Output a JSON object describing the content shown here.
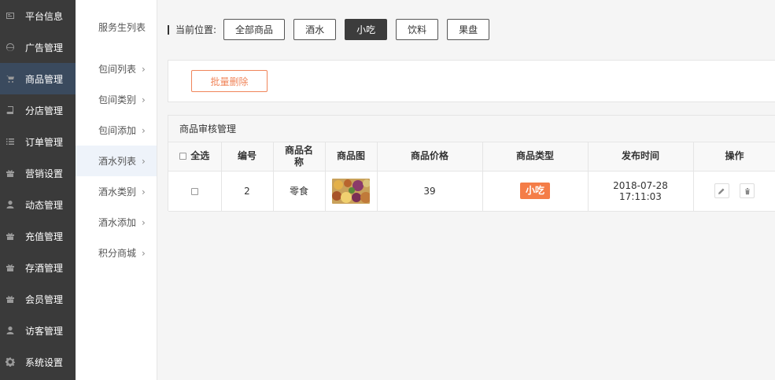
{
  "sidebar": {
    "items": [
      {
        "label": "平台信息",
        "icon": "id-card-icon",
        "active": false
      },
      {
        "label": "广告管理",
        "icon": "globe-icon",
        "active": false
      },
      {
        "label": "商品管理",
        "icon": "cart-icon",
        "active": true
      },
      {
        "label": "分店管理",
        "icon": "book-icon",
        "active": false
      },
      {
        "label": "订单管理",
        "icon": "list-icon",
        "active": false
      },
      {
        "label": "营销设置",
        "icon": "gift-icon",
        "active": false
      },
      {
        "label": "动态管理",
        "icon": "user-icon",
        "active": false
      },
      {
        "label": "充值管理",
        "icon": "gift-icon",
        "active": false
      },
      {
        "label": "存酒管理",
        "icon": "gift-icon",
        "active": false
      },
      {
        "label": "会员管理",
        "icon": "gift-icon",
        "active": false
      },
      {
        "label": "访客管理",
        "icon": "user-icon",
        "active": false
      },
      {
        "label": "系统设置",
        "icon": "gear-icon",
        "active": false
      }
    ]
  },
  "subnav": {
    "items": [
      {
        "label": "服务生列表",
        "chevron": false,
        "active": false
      },
      {
        "label": "包间列表",
        "chevron": true,
        "active": false
      },
      {
        "label": "包间类别",
        "chevron": true,
        "active": false
      },
      {
        "label": "包间添加",
        "chevron": true,
        "active": false
      },
      {
        "label": "酒水列表",
        "chevron": true,
        "active": true
      },
      {
        "label": "酒水类别",
        "chevron": true,
        "active": false
      },
      {
        "label": "酒水添加",
        "chevron": true,
        "active": false
      },
      {
        "label": "积分商城",
        "chevron": true,
        "active": false
      }
    ],
    "chevron_glyph": "›"
  },
  "breadcrumb": {
    "label": "当前位置:",
    "filters": [
      {
        "label": "全部商品",
        "active": false
      },
      {
        "label": "酒水",
        "active": false
      },
      {
        "label": "小吃",
        "active": true
      },
      {
        "label": "饮料",
        "active": false
      },
      {
        "label": "果盘",
        "active": false
      }
    ]
  },
  "toolbar": {
    "batch_delete_label": "批量删除"
  },
  "panel": {
    "title": "商品审核管理",
    "columns": {
      "select_all": "全选",
      "id": "编号",
      "name": "商品名称",
      "image": "商品图",
      "price": "商品价格",
      "type": "商品类型",
      "time": "发布时间",
      "actions": "操作"
    },
    "rows": [
      {
        "id": "2",
        "name": "零食",
        "image_icon": "snack-photo-icon",
        "price": "39",
        "type": "小吃",
        "date": "2018-07-28",
        "time": "17:11:03"
      }
    ]
  },
  "colors": {
    "sidebar_bg": "#3a3a3a",
    "sidebar_active": "#3a4a5e",
    "accent_orange": "#f47d48",
    "active_filter": "#3c3c3c"
  }
}
